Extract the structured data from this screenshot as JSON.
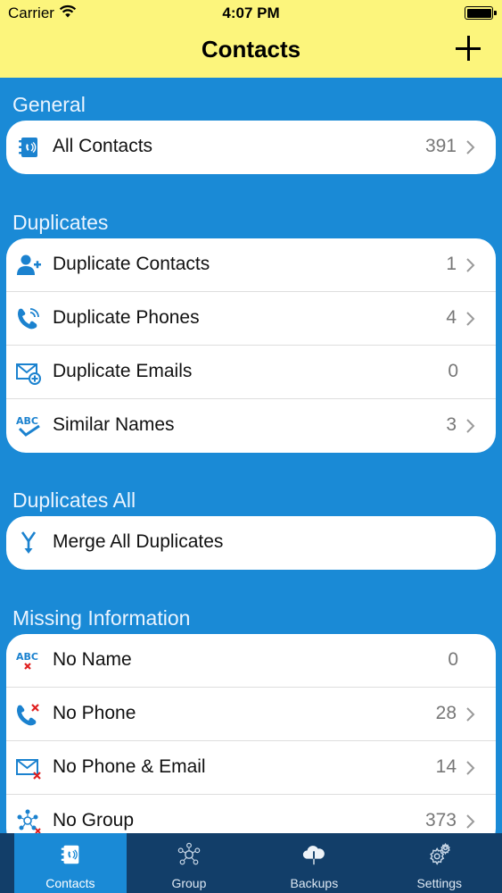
{
  "status_bar": {
    "carrier": "Carrier",
    "time": "4:07 PM"
  },
  "nav": {
    "title": "Contacts"
  },
  "sections": {
    "general": {
      "title": "General",
      "rows": [
        {
          "label": "All Contacts",
          "count": "391"
        }
      ]
    },
    "duplicates": {
      "title": "Duplicates",
      "rows": [
        {
          "label": "Duplicate Contacts",
          "count": "1"
        },
        {
          "label": "Duplicate Phones",
          "count": "4"
        },
        {
          "label": "Duplicate Emails",
          "count": "0"
        },
        {
          "label": "Similar Names",
          "count": "3"
        }
      ]
    },
    "duplicates_all": {
      "title": "Duplicates All",
      "rows": [
        {
          "label": "Merge All Duplicates"
        }
      ]
    },
    "missing": {
      "title": "Missing Information",
      "rows": [
        {
          "label": "No Name",
          "count": "0"
        },
        {
          "label": "No Phone",
          "count": "28"
        },
        {
          "label": "No Phone & Email",
          "count": "14"
        },
        {
          "label": "No Group",
          "count": "373"
        }
      ]
    }
  },
  "tabbar": {
    "tabs": [
      {
        "label": "Contacts",
        "icon": "address-book-icon",
        "active": true
      },
      {
        "label": "Group",
        "icon": "group-network-icon",
        "active": false
      },
      {
        "label": "Backups",
        "icon": "cloud-download-icon",
        "active": false
      },
      {
        "label": "Settings",
        "icon": "gear-icon",
        "active": false
      }
    ]
  },
  "colors": {
    "header": "#fcf57c",
    "background": "#1a8ad6",
    "tabbar": "#123e69",
    "icon_blue": "#1b82cf",
    "icon_red": "#e02020"
  }
}
